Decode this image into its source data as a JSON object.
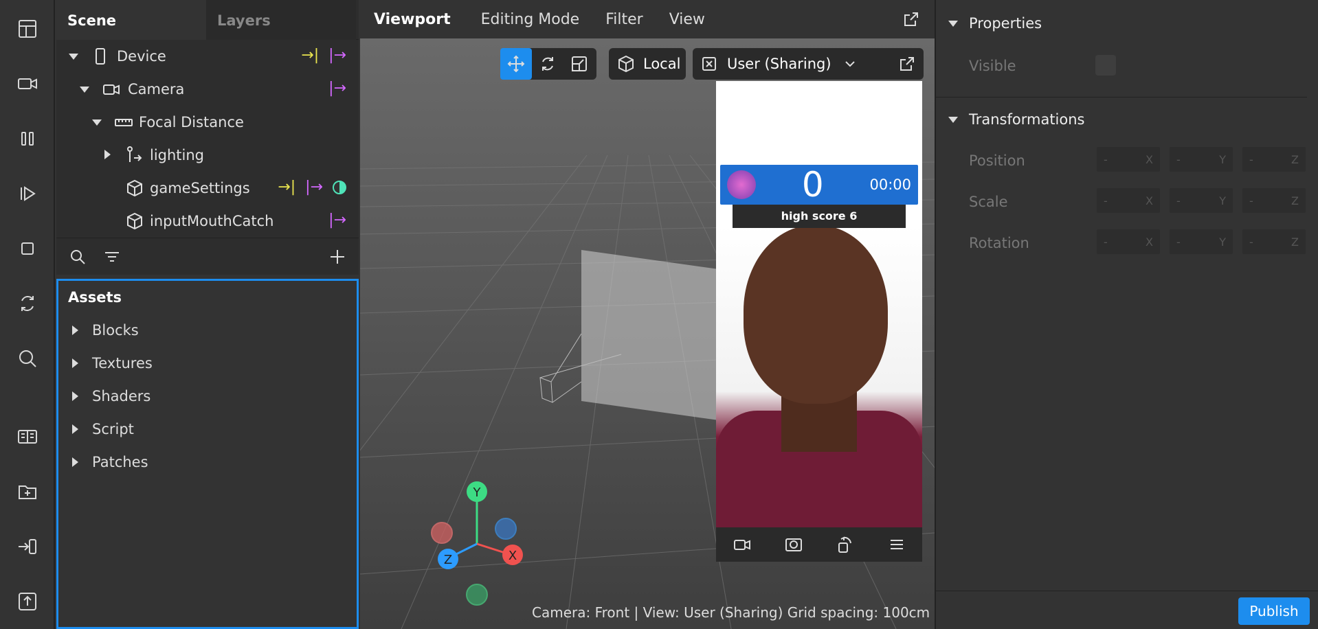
{
  "scene_panel": {
    "tabs": [
      "Scene",
      "Layers"
    ],
    "tree": [
      {
        "label": "Device",
        "icon": "device-icon",
        "badges": [
          "yellow-arrow",
          "purple-arrow"
        ]
      },
      {
        "label": "Camera",
        "icon": "camera-icon",
        "badges": [
          "purple-arrow"
        ]
      },
      {
        "label": "Focal Distance",
        "icon": "ruler-icon",
        "badges": []
      },
      {
        "label": "lighting",
        "icon": "light-icon",
        "badges": []
      },
      {
        "label": "gameSettings",
        "icon": "cube-icon",
        "badges": [
          "yellow-arrow",
          "purple-arrow",
          "teal-half"
        ]
      },
      {
        "label": "inputMouthCatch",
        "icon": "cube-icon",
        "badges": [
          "purple-arrow"
        ]
      }
    ]
  },
  "assets": {
    "title": "Assets",
    "items": [
      "Blocks",
      "Textures",
      "Shaders",
      "Script",
      "Patches"
    ]
  },
  "viewport": {
    "menu": [
      "Viewport",
      "Editing Mode",
      "Filter",
      "View"
    ],
    "space": "Local",
    "view_select": "User (Sharing)",
    "status": "Camera: Front | View: User (Sharing)   Grid spacing: 100cm"
  },
  "preview": {
    "score": "0",
    "timer": "00:00",
    "high_score": "high score 6"
  },
  "properties": {
    "title": "Properties",
    "visible_label": "Visible",
    "transform_title": "Transformations",
    "rows": [
      "Position",
      "Scale",
      "Rotation"
    ],
    "axes": [
      "X",
      "Y",
      "Z"
    ],
    "placeholder": "-"
  },
  "publish_label": "Publish",
  "colors": {
    "accent": "#1d8dee",
    "yellow": "#e9e44f",
    "purple": "#d368ff",
    "teal": "#4fe3b8"
  }
}
